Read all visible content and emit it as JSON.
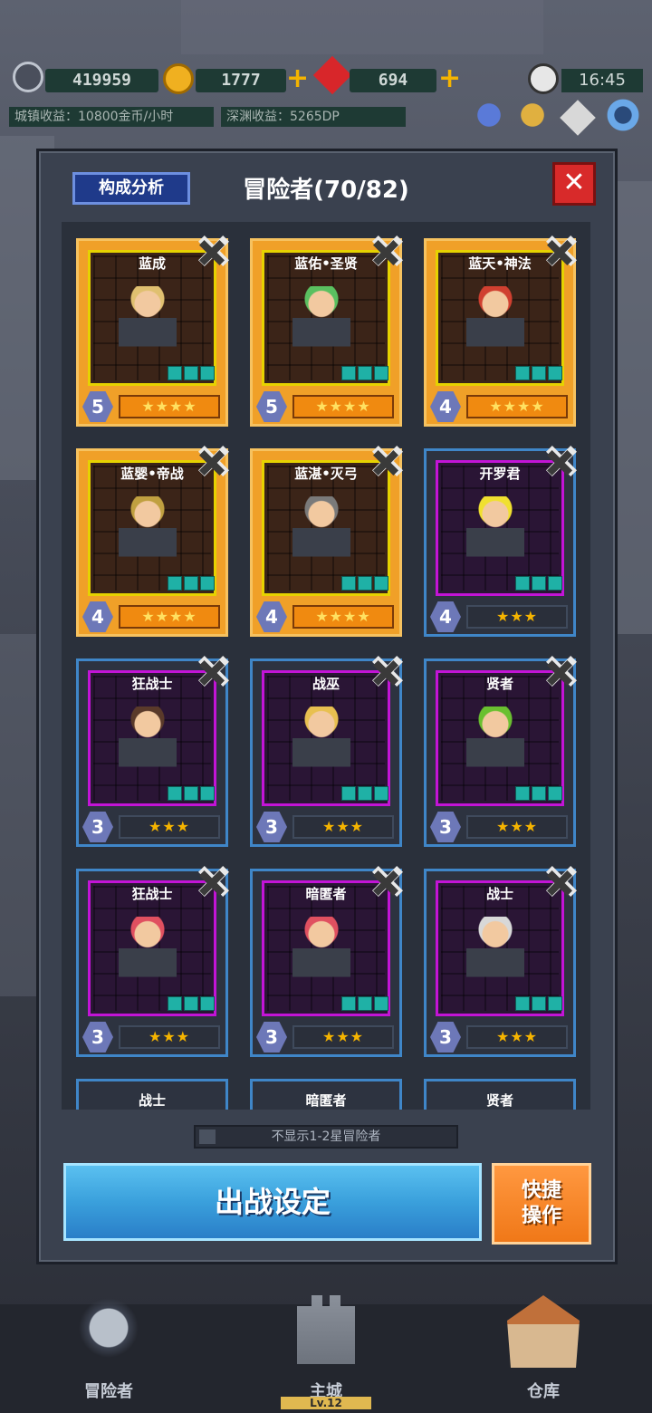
{
  "header": {
    "resources": [
      {
        "icon": "moon-sword-icon",
        "value": "419959"
      },
      {
        "icon": "gold-coin-icon",
        "value": "1777"
      },
      {
        "icon": "red-gem-icon",
        "value": "694"
      }
    ],
    "time": "16:45",
    "town_income": "城镇收益：10800金币/小时",
    "abyss_income": "深渊收益：5265DP"
  },
  "panel": {
    "analysis_label": "构成分析",
    "title": "冒险者(70/82)",
    "close_label": "✕",
    "filter_label": "不显示1-2星冒险者"
  },
  "cards": [
    {
      "name": "蓝成",
      "level": "5",
      "stars": "★★★★",
      "style": "gold"
    },
    {
      "name": "蓝佑•圣贤",
      "level": "5",
      "stars": "★★★★",
      "style": "gold"
    },
    {
      "name": "蓝天•神法",
      "level": "4",
      "stars": "★★★★",
      "style": "gold"
    },
    {
      "name": "蓝婴•帝战",
      "level": "4",
      "stars": "★★★★",
      "style": "gold"
    },
    {
      "name": "蓝湛•灭弓",
      "level": "4",
      "stars": "★★★★",
      "style": "gold"
    },
    {
      "name": "开罗君",
      "level": "4",
      "stars": "★★★",
      "style": "purple"
    },
    {
      "name": "狂战士",
      "level": "3",
      "stars": "★★★",
      "style": "purple"
    },
    {
      "name": "战巫",
      "level": "3",
      "stars": "★★★",
      "style": "purple"
    },
    {
      "name": "贤者",
      "level": "3",
      "stars": "★★★",
      "style": "purple"
    },
    {
      "name": "狂战士",
      "level": "3",
      "stars": "★★★",
      "style": "purple"
    },
    {
      "name": "暗匿者",
      "level": "3",
      "stars": "★★★",
      "style": "purple"
    },
    {
      "name": "战士",
      "level": "3",
      "stars": "★★★",
      "style": "purple"
    },
    {
      "name": "战士",
      "level": "",
      "stars": "",
      "style": "purple"
    },
    {
      "name": "暗匿者",
      "level": "",
      "stars": "",
      "style": "purple"
    },
    {
      "name": "贤者",
      "level": "",
      "stars": "",
      "style": "purple"
    }
  ],
  "actions": {
    "deploy_label": "出战设定",
    "quick_label_1": "快捷",
    "quick_label_2": "操作"
  },
  "nav": {
    "items": [
      {
        "label": "冒险者",
        "icon": "knight-helmet-icon"
      },
      {
        "label": "主城",
        "icon": "castle-icon"
      },
      {
        "label": "仓库",
        "icon": "warehouse-icon"
      }
    ],
    "main_city_level": "Lv.12"
  }
}
